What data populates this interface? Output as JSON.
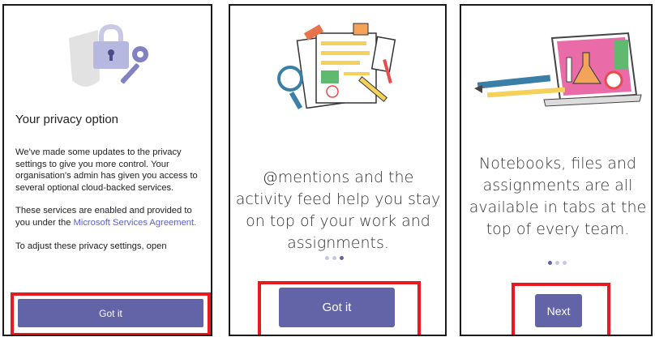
{
  "privacy": {
    "title": "Your privacy option",
    "paragraph1": "We've made some updates to the privacy settings to give you more control. Your organisation's admin has given you access to several optional cloud-backed services.",
    "paragraph2_prefix": "These services are enabled and provided to you under the ",
    "paragraph2_link": "Microsoft Services Agreement.",
    "paragraph3": "To adjust these privacy settings, open",
    "button_label": "Got it",
    "illustration_icons": [
      "shield-icon",
      "lock-icon",
      "key-icon"
    ]
  },
  "mentions": {
    "message": "@mentions and the activity feed help you stay on top of your work and assignments.",
    "button_label": "Got it",
    "page_indicator": {
      "total": 3,
      "active_index": 2
    },
    "illustration_icons": [
      "documents-icon",
      "magnifier-icon",
      "pencil-icon"
    ]
  },
  "notebooks": {
    "message": "Notebooks, files and assignments are all available in tabs at the top of every team.",
    "button_label": "Next",
    "page_indicator": {
      "total": 3,
      "active_index": 0
    },
    "illustration_icons": [
      "tablet-icon",
      "pen-icon",
      "flask-icon"
    ]
  },
  "colors": {
    "brand_purple": "#6264a7",
    "highlight_red": "#e8191f",
    "link_purple": "#5b5fc7"
  }
}
